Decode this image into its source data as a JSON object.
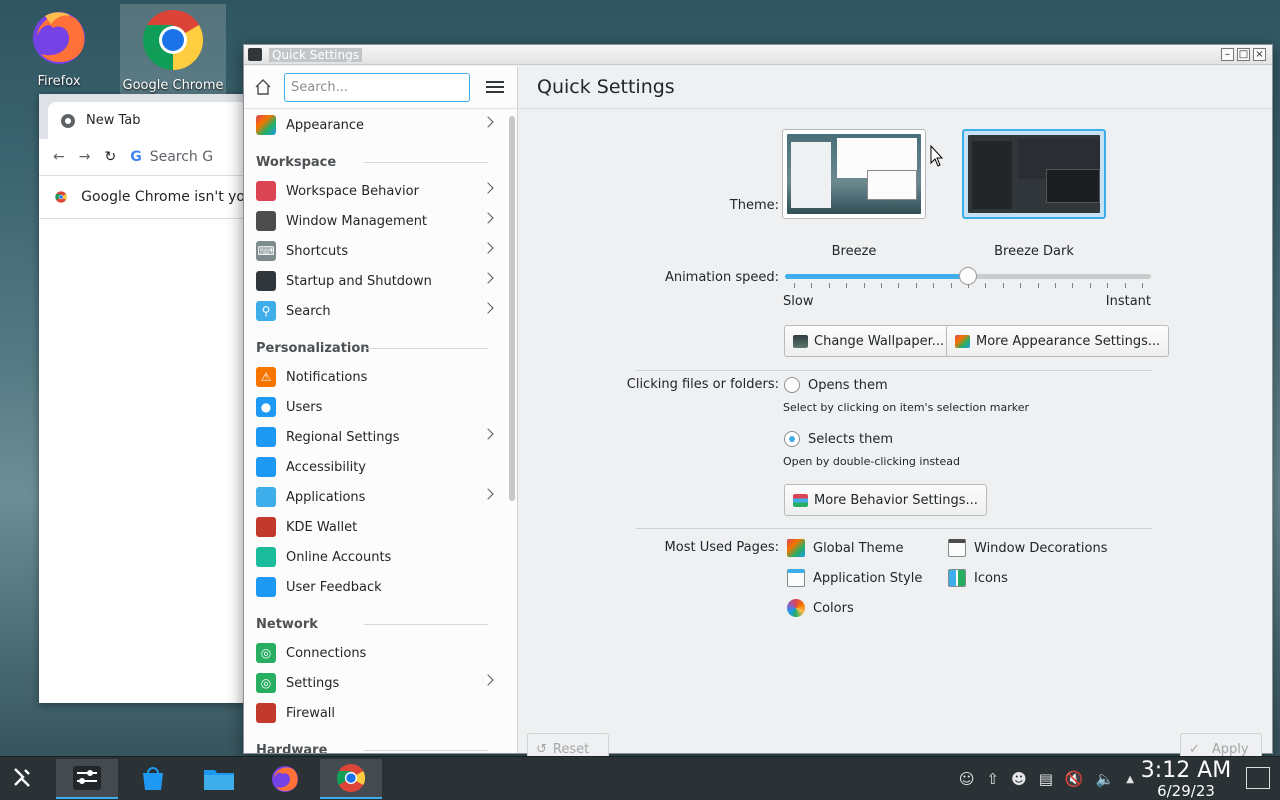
{
  "desktop": {
    "icons": [
      {
        "label": "Firefox"
      },
      {
        "label": "Google Chrome"
      }
    ]
  },
  "chrome_window": {
    "tab_title": "New Tab",
    "search_placeholder": "Search G",
    "info_text": "Google Chrome isn't yo"
  },
  "window": {
    "title": "Quick Settings",
    "search_placeholder": "Search...",
    "sidebar": {
      "top_item": "Appearance",
      "sections": [
        {
          "title": "Workspace",
          "items": [
            {
              "label": "Workspace Behavior",
              "chevron": true,
              "icon": "workspace-behavior-icon",
              "color": "#da4453"
            },
            {
              "label": "Window Management",
              "chevron": true,
              "icon": "window-management-icon",
              "color": "#4d4d4d"
            },
            {
              "label": "Shortcuts",
              "chevron": true,
              "icon": "keyboard-icon",
              "color": "#7f8c8d"
            },
            {
              "label": "Startup and Shutdown",
              "chevron": true,
              "icon": "monitor-icon",
              "color": "#31363b"
            },
            {
              "label": "Search",
              "chevron": true,
              "icon": "search-icon",
              "color": "#3daee9"
            }
          ]
        },
        {
          "title": "Personalization",
          "items": [
            {
              "label": "Notifications",
              "chevron": false,
              "icon": "bell-icon",
              "color": "#f67400"
            },
            {
              "label": "Users",
              "chevron": false,
              "icon": "users-icon",
              "color": "#1d99f3"
            },
            {
              "label": "Regional Settings",
              "chevron": true,
              "icon": "regional-icon",
              "color": "#1d99f3"
            },
            {
              "label": "Accessibility",
              "chevron": false,
              "icon": "accessibility-icon",
              "color": "#1d99f3"
            },
            {
              "label": "Applications",
              "chevron": true,
              "icon": "applications-icon",
              "color": "#3daee9"
            },
            {
              "label": "KDE Wallet",
              "chevron": false,
              "icon": "wallet-icon",
              "color": "#c0392b"
            },
            {
              "label": "Online Accounts",
              "chevron": false,
              "icon": "online-accounts-icon",
              "color": "#1abc9c"
            },
            {
              "label": "User Feedback",
              "chevron": false,
              "icon": "feedback-icon",
              "color": "#1d99f3"
            }
          ]
        },
        {
          "title": "Network",
          "items": [
            {
              "label": "Connections",
              "chevron": false,
              "icon": "globe-icon",
              "color": "#27ae60"
            },
            {
              "label": "Settings",
              "chevron": true,
              "icon": "globe-settings-icon",
              "color": "#27ae60"
            },
            {
              "label": "Firewall",
              "chevron": false,
              "icon": "firewall-icon",
              "color": "#c0392b"
            }
          ]
        },
        {
          "title": "Hardware",
          "items": []
        }
      ]
    },
    "main": {
      "title": "Quick Settings",
      "theme_label": "Theme:",
      "themes": [
        {
          "name": "Breeze",
          "selected": false
        },
        {
          "name": "Breeze Dark",
          "selected": true
        }
      ],
      "animation_label": "Animation speed:",
      "animation_value": 0.5,
      "slow_label": "Slow",
      "instant_label": "Instant",
      "change_wallpaper": "Change Wallpaper...",
      "more_appearance": "More Appearance Settings...",
      "clicking_label": "Clicking files or folders:",
      "opens_them": "Opens them",
      "opens_hint": "Select by clicking on item's selection marker",
      "selects_them": "Selects them",
      "selects_hint": "Open by double-clicking instead",
      "more_behavior": "More Behavior Settings...",
      "most_used_label": "Most Used Pages:",
      "most_used": [
        {
          "label": "Global Theme",
          "icon": "global-theme-icon"
        },
        {
          "label": "Window Decorations",
          "icon": "window-decorations-icon"
        },
        {
          "label": "Application Style",
          "icon": "application-style-icon"
        },
        {
          "label": "Icons",
          "icon": "icons-icon"
        },
        {
          "label": "Colors",
          "icon": "colors-icon"
        }
      ],
      "reset": "Reset",
      "apply": "Apply"
    }
  },
  "taskbar": {
    "time": "3:12 AM",
    "date": "6/29/23"
  },
  "colors": {
    "accent": "#3daee9",
    "window_bg": "#eff0f1",
    "taskbar_bg": "#2b3236"
  }
}
